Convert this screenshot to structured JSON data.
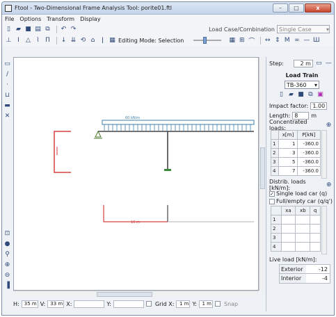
{
  "window": {
    "title": "Ftool - Two-Dimensional Frame Analysis Tool: porite01.ftl",
    "close_label": "x"
  },
  "menu": [
    "File",
    "Options",
    "Transform",
    "Display"
  ],
  "toolbar": {
    "load_case_label": "Load Case/Combination",
    "load_case_value": "Single Case",
    "editing_mode_label": "Editing Mode: Selection"
  },
  "canvas": {
    "load_label": "60 kN/m",
    "dim_label": "10 m"
  },
  "right_panel": {
    "step_label": "Step:",
    "step_value": "2 m",
    "load_train_title": "Load Train",
    "train_value": "TB-360",
    "impact_label": "Impact factor:",
    "impact_value": "1.00",
    "length_label": "Length:",
    "length_value": "8",
    "length_unit": "m",
    "conc_label": "Concentrated loads:",
    "conc_headers": [
      "",
      "x[m]",
      "P[kN]"
    ],
    "conc_rows": [
      {
        "n": "1",
        "x": "1",
        "p": "-360.0"
      },
      {
        "n": "2",
        "x": "3",
        "p": "-360.0"
      },
      {
        "n": "3",
        "x": "5",
        "p": "-360.0"
      },
      {
        "n": "4",
        "x": "7",
        "p": "-360.0"
      }
    ],
    "distrib_label": "Distrib. loads [kN/m]:",
    "single_car_label": "Single load car (q)",
    "full_empty_label": "Full/empty car (q/q')",
    "dist_headers": [
      "",
      "xa",
      "xb",
      "q"
    ],
    "dist_rows": [
      "1",
      "2",
      "3",
      "4"
    ],
    "live_label": "Live load [kN/m]:",
    "exterior_label": "Exterior",
    "exterior_value": "-12",
    "interior_label": "Interior",
    "interior_value": "-4"
  },
  "status": {
    "h_label": "H:",
    "h_value": "35 m",
    "v_label": "V:",
    "v_value": "33 m",
    "x_label": "X:",
    "y_label": "Y:",
    "grid_label": "Grid X:",
    "grid_x": "1 m",
    "grid_y_label": "Y:",
    "grid_y": "1 m",
    "snap_label": "Snap"
  }
}
